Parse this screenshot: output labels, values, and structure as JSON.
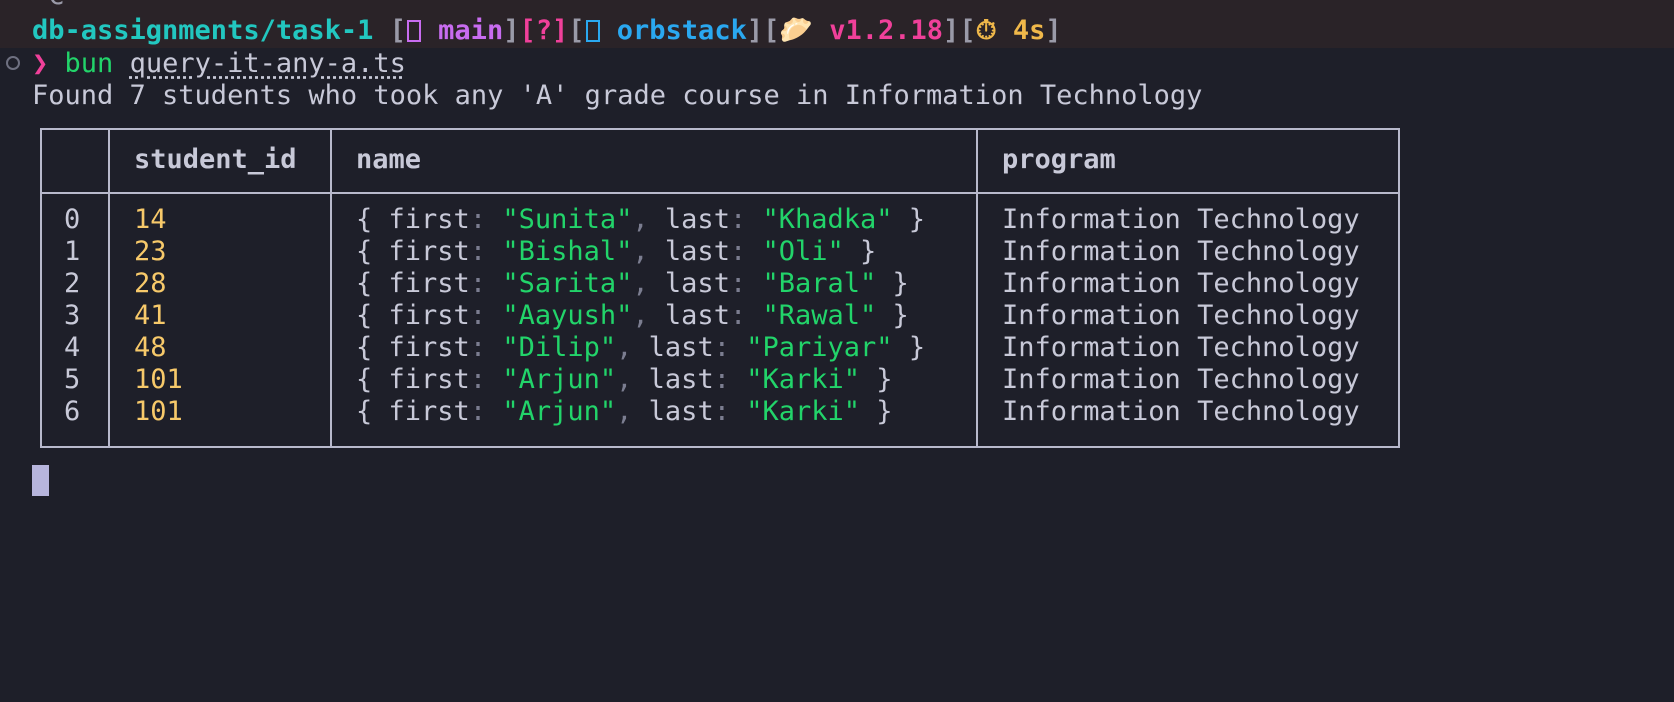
{
  "status_bar": {
    "cut_text": "^C",
    "dir": "db-assignments/task-1",
    "bracket_open": "[",
    "bracket_close": "]",
    "branch": "main",
    "git_status": "[?]",
    "context": "orbstack",
    "bun_version": "v1.2.18",
    "duration": "4s",
    "git_icon": "git-branch-icon",
    "docker_icon": "docker-icon",
    "bun_icon": "bun-bread-icon",
    "timer_icon": "stopwatch-icon"
  },
  "command": {
    "prompt": "❯",
    "program": "bun",
    "file": "query-it-any-a.ts"
  },
  "output": {
    "message": "Found 7 students who took any 'A' grade course in Information Technology"
  },
  "table": {
    "headers": [
      "",
      "student_id",
      "name",
      "program"
    ],
    "rows": [
      {
        "index": "0",
        "student_id": "14",
        "first": "\"Sunita\"",
        "last": "\"Khadka\"",
        "program": "Information Technology"
      },
      {
        "index": "1",
        "student_id": "23",
        "first": "\"Bishal\"",
        "last": "\"Oli\"",
        "program": "Information Technology"
      },
      {
        "index": "2",
        "student_id": "28",
        "first": "\"Sarita\"",
        "last": "\"Baral\"",
        "program": "Information Technology"
      },
      {
        "index": "3",
        "student_id": "41",
        "first": "\"Aayush\"",
        "last": "\"Rawal\"",
        "program": "Information Technology"
      },
      {
        "index": "4",
        "student_id": "48",
        "first": "\"Dilip\"",
        "last": "\"Pariyar\"",
        "program": "Information Technology"
      },
      {
        "index": "5",
        "student_id": "101",
        "first": "\"Arjun\"",
        "last": "\"Karki\"",
        "program": "Information Technology"
      },
      {
        "index": "6",
        "student_id": "101",
        "first": "\"Arjun\"",
        "last": "\"Karki\"",
        "program": "Information Technology"
      }
    ],
    "tokens": {
      "open_brace": "{",
      "close_brace": "}",
      "first_key": "first",
      "last_key": "last",
      "colon": ":",
      "comma": ","
    }
  },
  "colors": {
    "background": "#1e1f29",
    "number": "#f7c96a",
    "string": "#22d46a",
    "accent_pink": "#f0409a",
    "border": "#b8b9cc"
  }
}
